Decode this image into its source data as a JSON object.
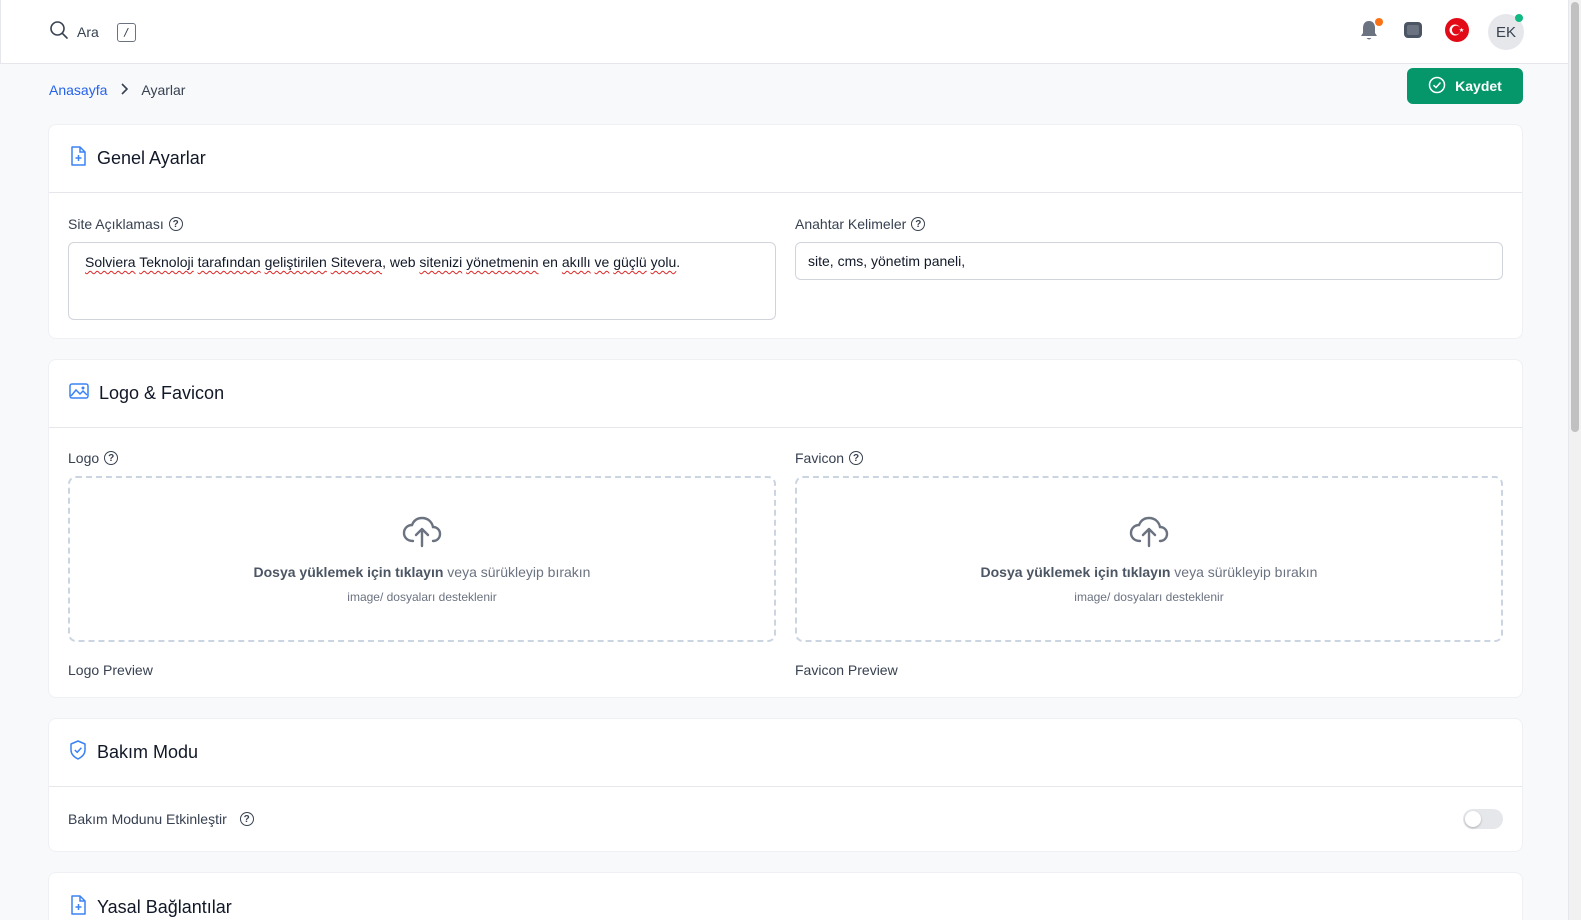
{
  "topbar": {
    "search_label": "Ara",
    "search_shortcut": "/",
    "user_initials": "EK",
    "notification_dot_color": "#f97316",
    "status_dot_color": "#10b981"
  },
  "breadcrumb": {
    "home": "Anasayfa",
    "current": "Ayarlar"
  },
  "save_button": "Kaydet",
  "general": {
    "title": "Genel Ayarlar",
    "site_description_label": "Site Açıklaması",
    "site_description_words": [
      {
        "t": "Solviera",
        "spell": true
      },
      {
        "t": " ",
        "spell": false
      },
      {
        "t": "Teknoloji",
        "spell": true
      },
      {
        "t": " ",
        "spell": false
      },
      {
        "t": "tarafından",
        "spell": true
      },
      {
        "t": " ",
        "spell": false
      },
      {
        "t": "geliştirilen",
        "spell": true
      },
      {
        "t": " ",
        "spell": false
      },
      {
        "t": "Sitevera",
        "spell": true
      },
      {
        "t": ", web ",
        "spell": false
      },
      {
        "t": "sitenizi",
        "spell": true
      },
      {
        "t": " ",
        "spell": false
      },
      {
        "t": "yönetmenin",
        "spell": true
      },
      {
        "t": " en ",
        "spell": false
      },
      {
        "t": "akıllı",
        "spell": true
      },
      {
        "t": " ",
        "spell": false
      },
      {
        "t": "ve",
        "spell": true
      },
      {
        "t": " ",
        "spell": false
      },
      {
        "t": "güçlü",
        "spell": true
      },
      {
        "t": " ",
        "spell": false
      },
      {
        "t": "yolu",
        "spell": true
      },
      {
        "t": ".",
        "spell": false
      }
    ],
    "keywords_label": "Anahtar Kelimeler",
    "keywords_value": "site, cms, yönetim paneli,"
  },
  "logo_section": {
    "title": "Logo & Favicon",
    "logo_label": "Logo",
    "favicon_label": "Favicon",
    "upload_strong": "Dosya yüklemek için tıklayın",
    "upload_rest": " veya sürükleyip bırakın",
    "upload_hint": "image/ dosyaları desteklenir",
    "logo_preview": "Logo Preview",
    "favicon_preview": "Favicon Preview"
  },
  "maintenance": {
    "title": "Bakım Modu",
    "toggle_label": "Bakım Modunu Etkinleştir",
    "enabled": false
  },
  "legal": {
    "title": "Yasal Bağlantılar"
  },
  "colors": {
    "primary_link": "#2563eb",
    "save_green": "#059669",
    "icon_blue": "#3b82f6"
  }
}
